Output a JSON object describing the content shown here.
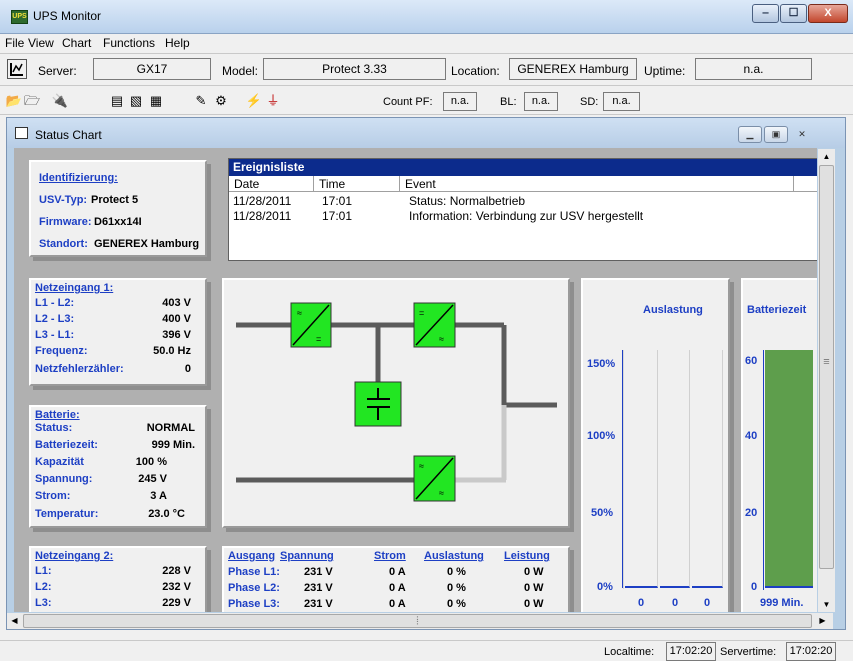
{
  "window": {
    "title": "UPS Monitor",
    "icon_text": "UPS",
    "min": "‒",
    "max": "☐",
    "close": "X"
  },
  "menu": [
    "File",
    "View",
    "Chart",
    "Functions",
    "Help"
  ],
  "serverbar": {
    "server_label": "Server:",
    "server_value": "GX17",
    "model_label": "Model:",
    "model_value": "Protect 3.33",
    "location_label": "Location:",
    "location_value": "GENEREX Hamburg",
    "uptime_label": "Uptime:",
    "uptime_value": "n.a."
  },
  "toolbar": {
    "countpf_label": "Count PF:",
    "countpf_value": "n.a.",
    "bl_label": "BL:",
    "bl_value": "n.a.",
    "sd_label": "SD:",
    "sd_value": "n.a."
  },
  "mdi": {
    "title": "Status Chart"
  },
  "identifizierung": {
    "title": "Identifizierung:",
    "usv_typ_label": "USV-Typ:",
    "usv_typ_value": "Protect 5",
    "firmware_label": "Firmware:",
    "firmware_value": "D61xx14I",
    "standort_label": "Standort:",
    "standort_value": "GENEREX Hamburg"
  },
  "ereignisliste": {
    "title": "Ereignisliste",
    "columns": [
      "Date",
      "Time",
      "Event"
    ],
    "rows": [
      {
        "date": "11/28/2011",
        "time": "17:01",
        "event": "Status: Normalbetrieb"
      },
      {
        "date": "11/28/2011",
        "time": "17:01",
        "event": "Information: Verbindung zur USV hergestellt"
      }
    ]
  },
  "netzeingang1": {
    "title": "Netzeingang 1:",
    "rows": [
      {
        "label": "L1 - L2:",
        "value": "403 V"
      },
      {
        "label": "L2 - L3:",
        "value": "400 V"
      },
      {
        "label": "L3 - L1:",
        "value": "396 V"
      },
      {
        "label": "Frequenz:",
        "value": "50.0 Hz"
      },
      {
        "label": "Netzfehlerzähler:",
        "value": "0"
      }
    ]
  },
  "batterie": {
    "title": "Batterie:",
    "rows": [
      {
        "label": "Status:",
        "value": "NORMAL"
      },
      {
        "label": "Batteriezeit:",
        "value": "999 Min."
      },
      {
        "label": "Kapazität",
        "value": "100 %"
      },
      {
        "label": "Spannung:",
        "value": "245 V"
      },
      {
        "label": "Strom:",
        "value": "3 A"
      },
      {
        "label": "Temperatur:",
        "value": "23.0 °C"
      }
    ]
  },
  "netzeingang2": {
    "title": "Netzeingang 2:",
    "rows": [
      {
        "label": "L1:",
        "value": "228 V"
      },
      {
        "label": "L2:",
        "value": "232 V"
      },
      {
        "label": "L3:",
        "value": "229 V"
      }
    ]
  },
  "ausgang": {
    "headers": [
      "Ausgang",
      "Spannung",
      "Strom",
      "Auslastung",
      "Leistung"
    ],
    "rows": [
      {
        "phase": "Phase L1:",
        "spannung": "231 V",
        "strom": "0 A",
        "auslastung": "0 %",
        "leistung": "0 W"
      },
      {
        "phase": "Phase L2:",
        "spannung": "231 V",
        "strom": "0 A",
        "auslastung": "0 %",
        "leistung": "0 W"
      },
      {
        "phase": "Phase L3:",
        "spannung": "231 V",
        "strom": "0 A",
        "auslastung": "0 %",
        "leistung": "0 W"
      }
    ]
  },
  "auslastung": {
    "title": "Auslastung",
    "ticks": [
      "150%",
      "100%",
      "50%",
      "0%"
    ],
    "values": [
      "0",
      "0",
      "0"
    ]
  },
  "batteriezeit": {
    "title": "Batteriezeit",
    "ticks": [
      "60",
      "40",
      "20",
      "0"
    ],
    "value_label": "999 Min.",
    "fill_fraction": 1.0
  },
  "statusbar": {
    "localtime_label": "Localtime:",
    "localtime_value": "17:02:20",
    "servertime_label": "Servertime:",
    "servertime_value": "17:02:20"
  },
  "colors": {
    "accent": "#1d3fc4",
    "header": "#0c2b8c",
    "converter": "#22e622",
    "battery_bar": "#5e9e4c"
  }
}
